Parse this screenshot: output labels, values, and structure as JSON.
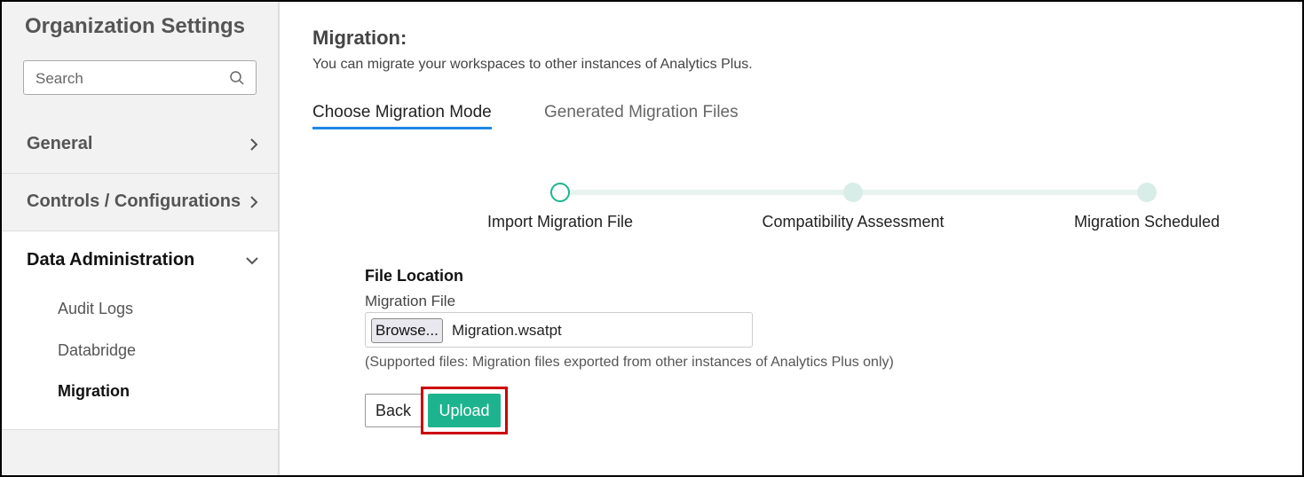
{
  "sidebar": {
    "title": "Organization Settings",
    "search_placeholder": "Search",
    "items": [
      {
        "label": "General"
      },
      {
        "label": "Controls / Configurations"
      },
      {
        "label": "Data Administration"
      }
    ],
    "subitems": [
      {
        "label": "Audit Logs"
      },
      {
        "label": "Databridge"
      },
      {
        "label": "Migration"
      }
    ]
  },
  "main": {
    "title": "Migration:",
    "description": "You can migrate your workspaces to other instances of Analytics Plus.",
    "tabs": [
      {
        "label": "Choose Migration Mode"
      },
      {
        "label": "Generated Migration Files"
      }
    ],
    "steps": [
      {
        "label": "Import Migration File"
      },
      {
        "label": "Compatibility Assessment"
      },
      {
        "label": "Migration Scheduled"
      }
    ],
    "form": {
      "section": "File Location",
      "field_label": "Migration File",
      "browse_label": "Browse...",
      "file_name": "Migration.wsatpt",
      "hint": "(Supported files: Migration files exported from other instances of Analytics Plus only)",
      "back_label": "Back",
      "upload_label": "Upload"
    }
  },
  "colors": {
    "accent": "#1db38e",
    "tab_underline": "#1e88e5",
    "highlight": "#cc0000"
  }
}
